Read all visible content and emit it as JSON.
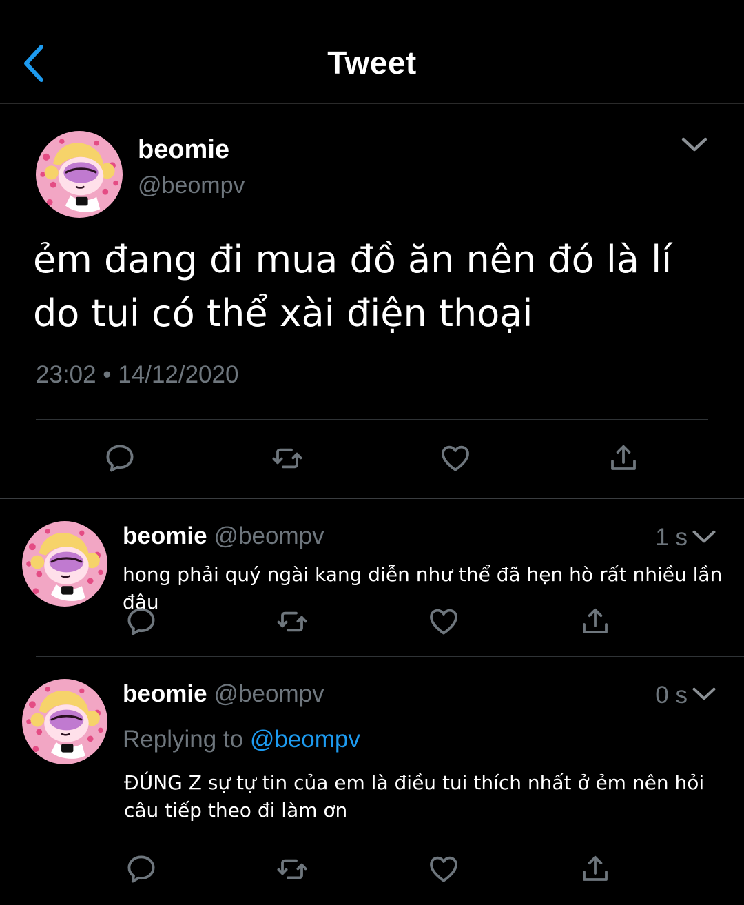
{
  "header": {
    "title": "Tweet",
    "back_icon": "chevron-left-icon"
  },
  "colors": {
    "accent": "#1d9bf0",
    "muted": "#6e767d",
    "background": "#000000"
  },
  "main_tweet": {
    "name": "beomie",
    "handle": "@beompv",
    "text": "ẻm đang đi mua đồ ăn nên đó là lí do tui có thể xài điện thoại",
    "timestamp": "23:02 • 14/12/2020"
  },
  "replies": [
    {
      "name": "beomie",
      "handle": "@beompv",
      "time": "1 s",
      "text": "hong phải quý ngài kang diễn như thể đã hẹn hò rất nhiều lần đâu"
    },
    {
      "name": "beomie",
      "handle": "@beompv",
      "time": "0 s",
      "replying_label": "Replying to",
      "replying_to": "@beompv",
      "text": "ĐÚNG Z sự tự tin của em là điều tui thích nhất ở ẻm nên hỏi câu tiếp theo đi làm ơn"
    }
  ],
  "actions": [
    "reply-icon",
    "retweet-icon",
    "like-icon",
    "share-icon"
  ]
}
